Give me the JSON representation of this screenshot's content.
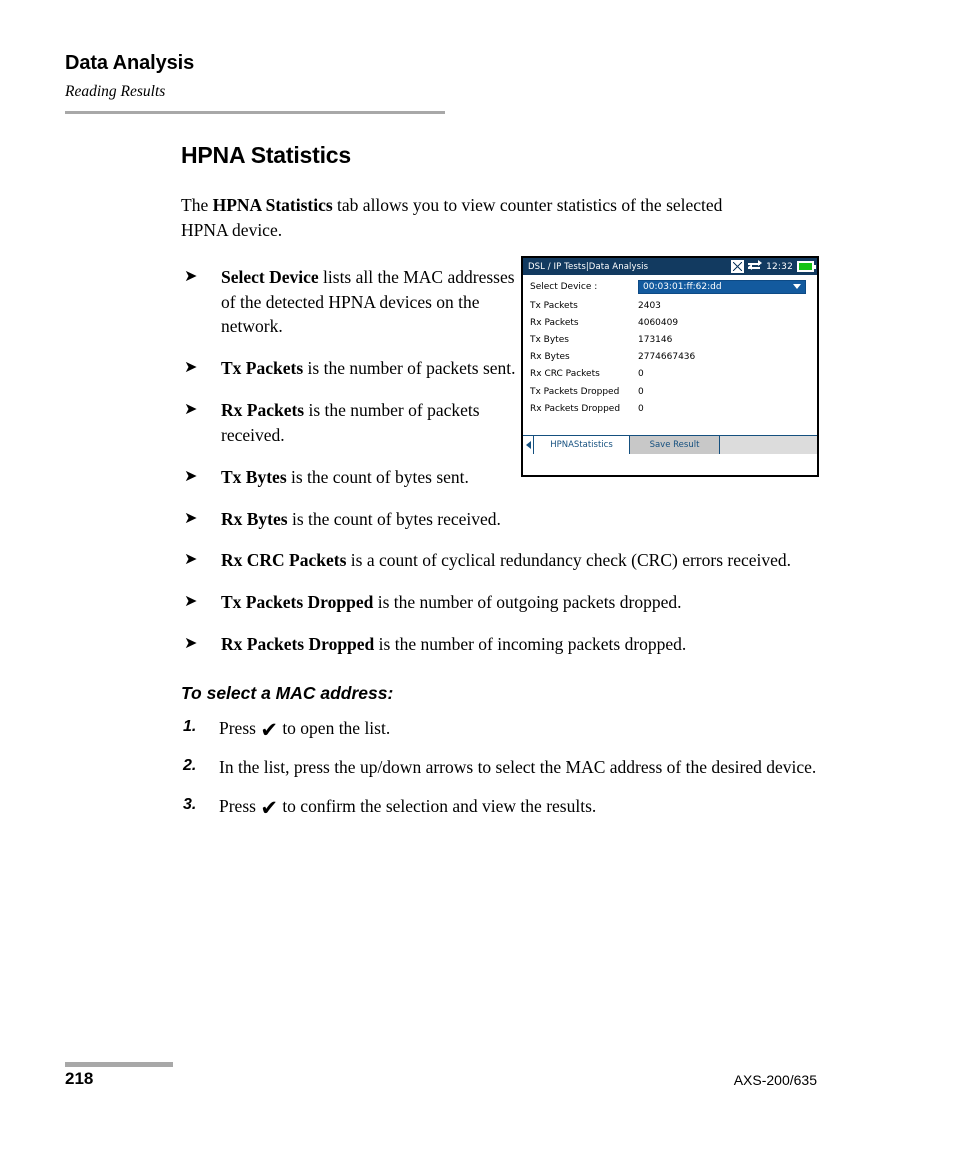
{
  "header": {
    "chapter": "Data Analysis",
    "section": "Reading Results"
  },
  "main": {
    "title": "HPNA Statistics",
    "intro_before": "The ",
    "intro_bold": "HPNA Statistics",
    "intro_after": " tab allows you to view counter statistics of the selected HPNA device.",
    "bullet_marker": "➤",
    "bullets": [
      {
        "term": "Select Device",
        "text": " lists all the MAC addresses of the detected HPNA devices on the network."
      },
      {
        "term": "Tx Packets",
        "text": " is the number of packets sent."
      },
      {
        "term": "Rx Packets",
        "text": " is the number of packets received."
      },
      {
        "term": "Tx Bytes",
        "text": " is the count of bytes sent."
      },
      {
        "term": "Rx Bytes",
        "text": " is the count of bytes received."
      },
      {
        "term": "Rx CRC Packets",
        "text": " is a count of cyclical redundancy check (CRC) errors received."
      },
      {
        "term": "Tx Packets Dropped",
        "text": " is the number of outgoing packets dropped."
      },
      {
        "term": "Rx Packets Dropped",
        "text": " is the number of incoming packets dropped."
      }
    ],
    "procedure_title": "To select a MAC address:",
    "check_glyph": "✔",
    "steps": [
      {
        "num": "1.",
        "before": "Press ",
        "after": " to open the list.",
        "has_check": true
      },
      {
        "num": "2.",
        "before": "In the list, press the up/down arrows to select the MAC address of the desired device.",
        "after": "",
        "has_check": false
      },
      {
        "num": "3.",
        "before": "Press ",
        "after": " to confirm the selection and view the results.",
        "has_check": true
      }
    ]
  },
  "device": {
    "titlebar": {
      "title": "DSL / IP Tests|Data Analysis",
      "time": "12:32",
      "icons": [
        "hourglass-icon",
        "network-icon",
        "battery-icon"
      ]
    },
    "select_device": {
      "label": "Select Device :",
      "value": "00:03:01:ff:62:dd"
    },
    "stats": [
      {
        "label": "Tx Packets",
        "value": "2403"
      },
      {
        "label": "Rx Packets",
        "value": "4060409"
      },
      {
        "label": "Tx Bytes",
        "value": "173146"
      },
      {
        "label": "Rx Bytes",
        "value": "2774667436"
      },
      {
        "label": "Rx CRC Packets",
        "value": "0"
      },
      {
        "label": "Tx Packets Dropped",
        "value": "0"
      },
      {
        "label": "Rx Packets Dropped",
        "value": "0"
      }
    ],
    "tabs": [
      {
        "label": "HPNAStatistics",
        "active": true
      },
      {
        "label": "Save Result",
        "active": false
      }
    ],
    "colors": {
      "titlebar_bg": "#123a60",
      "combo_bg": "#135a9e",
      "tab_text": "#15507f",
      "battery_fill": "#16c216"
    }
  },
  "footer": {
    "page_number": "218",
    "document_id": "AXS-200/635"
  }
}
